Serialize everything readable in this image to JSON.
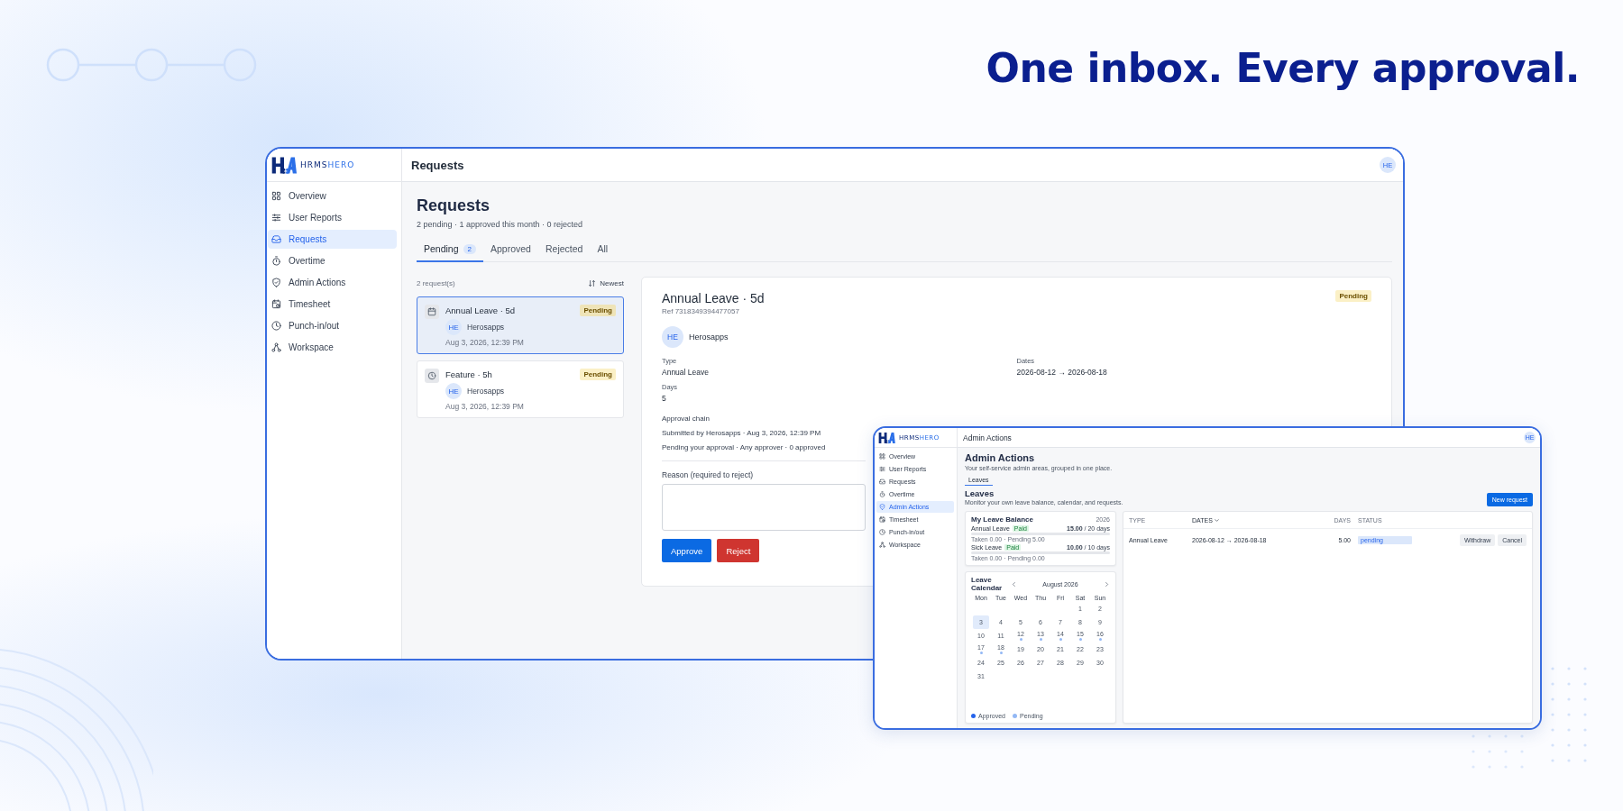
{
  "headline": "One inbox. Every approval.",
  "main_window": {
    "brand": {
      "left": "HRMS",
      "right": "HERO"
    },
    "sidebar": {
      "items": [
        {
          "label": "Overview",
          "selected": false
        },
        {
          "label": "User Reports",
          "selected": false
        },
        {
          "label": "Requests",
          "selected": true
        },
        {
          "label": "Overtime",
          "selected": false
        },
        {
          "label": "Admin Actions",
          "selected": false
        },
        {
          "label": "Timesheet",
          "selected": false
        },
        {
          "label": "Punch-in/out",
          "selected": false
        },
        {
          "label": "Workspace",
          "selected": false
        }
      ]
    },
    "header": {
      "title": "Requests",
      "avatar": "HE"
    },
    "page": {
      "title": "Requests",
      "subtitle": "2 pending · 1 approved this month · 0 rejected"
    },
    "tabs": [
      {
        "label": "Pending",
        "count": "2",
        "selected": true
      },
      {
        "label": "Approved",
        "selected": false
      },
      {
        "label": "Rejected",
        "selected": false
      },
      {
        "label": "All",
        "selected": false
      }
    ],
    "list": {
      "count": "2 request(s)",
      "sort": "Newest",
      "items": [
        {
          "title": "Annual Leave · 5d",
          "status": "Pending",
          "avatar": "HE",
          "name": "Herosapps",
          "time": "Aug 3, 2026, 12:39 PM",
          "selected": true
        },
        {
          "title": "Feature · 5h",
          "status": "Pending",
          "avatar": "HE",
          "name": "Herosapps",
          "time": "Aug 3, 2026, 12:39 PM",
          "selected": false
        }
      ]
    },
    "detail": {
      "title": "Annual Leave · 5d",
      "ref": "Ref 7318349394477057",
      "status": "Pending",
      "avatar": "HE",
      "name": "Herosapps",
      "fields": [
        {
          "label": "Type",
          "value": "Annual Leave"
        },
        {
          "label": "Dates",
          "value": "2026-08-12 → 2026-08-18"
        },
        {
          "label": "Days",
          "value": "5"
        }
      ],
      "approval_chain": {
        "title": "Approval chain",
        "lines": [
          "Submitted by Herosapps · Aug 3, 2026, 12:39 PM",
          "Pending your approval · Any approver · 0 approved"
        ]
      },
      "reason": {
        "label": "Reason (required to reject)"
      },
      "buttons": [
        {
          "label": "Approve",
          "kind": "primary"
        },
        {
          "label": "Reject",
          "kind": "danger"
        }
      ]
    }
  },
  "inset_window": {
    "brand": {
      "left": "HRMS",
      "right": "HERO"
    },
    "sidebar": {
      "items": [
        {
          "label": "Overview",
          "selected": false
        },
        {
          "label": "User Reports",
          "selected": false
        },
        {
          "label": "Requests",
          "selected": false
        },
        {
          "label": "Overtime",
          "selected": false
        },
        {
          "label": "Admin Actions",
          "selected": true
        },
        {
          "label": "Timesheet",
          "selected": false
        },
        {
          "label": "Punch-in/out",
          "selected": false
        },
        {
          "label": "Workspace",
          "selected": false
        }
      ]
    },
    "header": {
      "title": "Admin Actions",
      "avatar": "HE"
    },
    "page": {
      "title": "Admin Actions",
      "subtitle": "Your self-service admin areas, grouped in one place."
    },
    "tabs": [
      {
        "label": "Leaves",
        "selected": true
      }
    ],
    "section": {
      "title": "Leaves",
      "subtitle": "Monitor your own leave balance, calendar, and requests.",
      "button": "New request"
    },
    "balance": {
      "title": "My Leave Balance",
      "year": "2026",
      "rows": [
        {
          "name": "Annual Leave",
          "tag": "Paid",
          "amount": "**15.00** / 20 days",
          "note": "Taken 0.00 · Pending 5.00"
        },
        {
          "name": "Sick Leave",
          "tag": "Paid",
          "amount": "**10.00** / 10 days",
          "note": "Taken 0.00 · Pending 0.00"
        }
      ]
    },
    "calendar": {
      "title": "Leave Calendar",
      "month": "August 2026",
      "weekdays": [
        "Mon",
        "Tue",
        "Wed",
        "Thu",
        "Fri",
        "Sat",
        "Sun"
      ],
      "weeks": [
        [
          {
            "day": "1",
            "selected": false,
            "pending": false
          },
          {
            "day": "2",
            "selected": false,
            "pending": false
          }
        ],
        [
          {
            "day": "3",
            "selected": true,
            "pending": false
          },
          {
            "day": "4",
            "selected": false,
            "pending": false
          },
          {
            "day": "5",
            "selected": false,
            "pending": false
          },
          {
            "day": "6",
            "selected": false,
            "pending": false
          },
          {
            "day": "7",
            "selected": false,
            "pending": false
          },
          {
            "day": "8",
            "selected": false,
            "pending": false
          },
          {
            "day": "9",
            "selected": false,
            "pending": false
          }
        ],
        [
          {
            "day": "10",
            "selected": false,
            "pending": false
          },
          {
            "day": "11",
            "selected": false,
            "pending": false
          },
          {
            "day": "12",
            "selected": false,
            "pending": true
          },
          {
            "day": "13",
            "selected": false,
            "pending": true
          },
          {
            "day": "14",
            "selected": false,
            "pending": true
          },
          {
            "day": "15",
            "selected": false,
            "pending": true
          },
          {
            "day": "16",
            "selected": false,
            "pending": true
          }
        ],
        [
          {
            "day": "17",
            "selected": false,
            "pending": true
          },
          {
            "day": "18",
            "selected": false,
            "pending": true
          },
          {
            "day": "19",
            "selected": false,
            "pending": false
          },
          {
            "day": "20",
            "selected": false,
            "pending": false
          },
          {
            "day": "21",
            "selected": false,
            "pending": false
          },
          {
            "day": "22",
            "selected": false,
            "pending": false
          },
          {
            "day": "23",
            "selected": false,
            "pending": false
          }
        ],
        [
          {
            "day": "24",
            "selected": false,
            "pending": false
          },
          {
            "day": "25",
            "selected": false,
            "pending": false
          },
          {
            "day": "26",
            "selected": false,
            "pending": false
          },
          {
            "day": "27",
            "selected": false,
            "pending": false
          },
          {
            "day": "28",
            "selected": false,
            "pending": false
          },
          {
            "day": "29",
            "selected": false,
            "pending": false
          },
          {
            "day": "30",
            "selected": false,
            "pending": false
          }
        ],
        [
          {
            "day": "31",
            "selected": false,
            "pending": false
          }
        ]
      ],
      "legend": [
        {
          "label": "Approved",
          "color": "#2563eb"
        },
        {
          "label": "Pending",
          "color": "#93b8f5"
        }
      ]
    },
    "table": {
      "columns": [
        {
          "label": "TYPE",
          "sorted": false
        },
        {
          "label": "DATES",
          "sorted": true
        },
        {
          "label": "DAYS",
          "sorted": false
        },
        {
          "label": "STATUS",
          "sorted": false
        }
      ],
      "rows": [
        {
          "type": "Annual Leave",
          "dates": "2026-08-12 → 2026-08-18",
          "days": "5.00",
          "status": "pending",
          "actions": [
            "Withdraw",
            "Cancel"
          ]
        }
      ]
    }
  }
}
